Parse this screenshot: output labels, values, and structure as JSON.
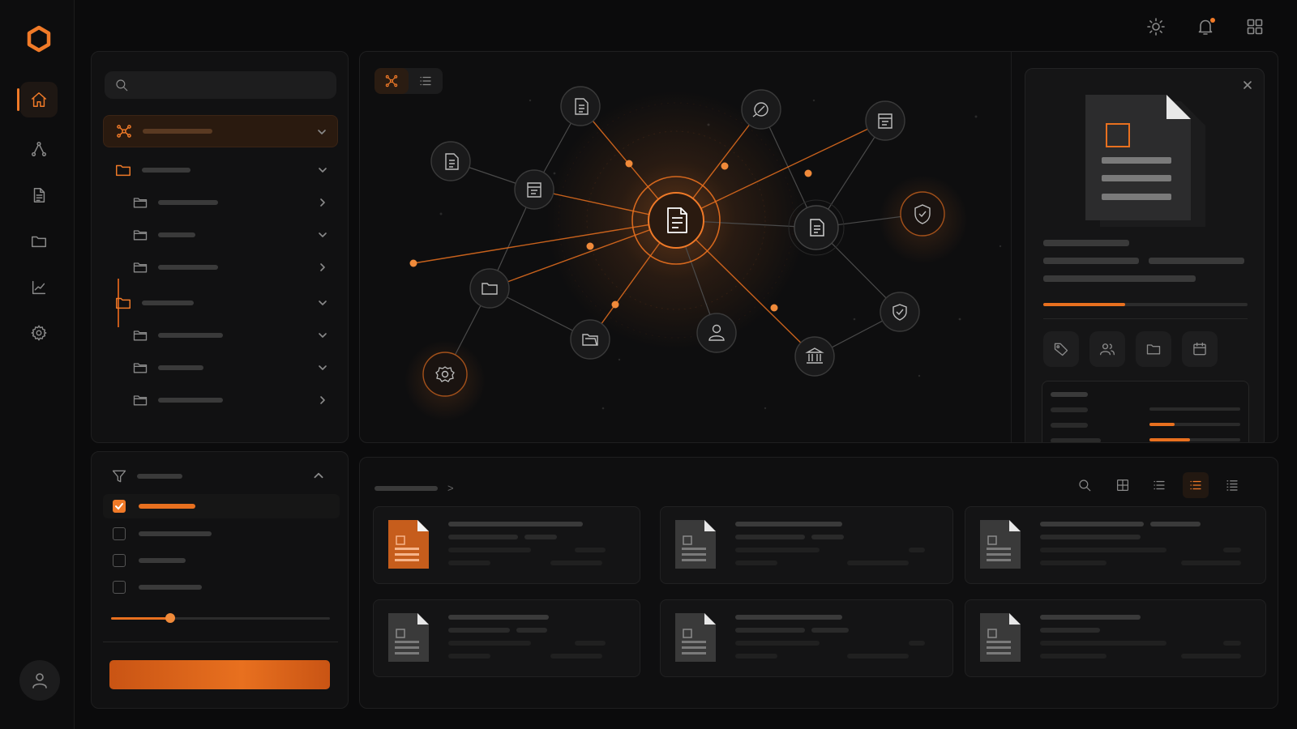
{
  "app": {
    "accent": "#f07a28",
    "background": "#0b0b0c"
  },
  "rail": {
    "logo": "hexagon-logo-icon",
    "items": [
      {
        "icon": "home-icon",
        "active": true
      },
      {
        "icon": "graph-icon",
        "active": false
      },
      {
        "icon": "document-icon",
        "active": false
      },
      {
        "icon": "folder-icon",
        "active": false
      },
      {
        "icon": "analytics-icon",
        "active": false
      },
      {
        "icon": "settings-icon",
        "active": false
      }
    ],
    "avatar": "user-icon"
  },
  "topbar": {
    "icons": [
      "sun-icon",
      "bell-icon",
      "apps-grid-icon"
    ],
    "notification_dot": true
  },
  "tree": {
    "search": {
      "value": "",
      "placeholder": ""
    },
    "rows": [
      {
        "level": 0,
        "icon": "network-icon",
        "expanded": true,
        "active": true
      },
      {
        "level": 0,
        "icon": "folder-icon",
        "expanded": true
      },
      {
        "level": 1,
        "icon": "folder-icon",
        "expanded": false
      },
      {
        "level": 1,
        "icon": "folder-icon",
        "expanded": true
      },
      {
        "level": 1,
        "icon": "folder-icon",
        "expanded": false
      },
      {
        "level": 0,
        "icon": "folder-icon",
        "expanded": true
      },
      {
        "level": 1,
        "icon": "folder-icon",
        "expanded": true
      },
      {
        "level": 1,
        "icon": "folder-icon",
        "expanded": true
      },
      {
        "level": 1,
        "icon": "folder-icon",
        "expanded": false
      }
    ]
  },
  "filter": {
    "icon": "filter-icon",
    "expanded": true,
    "options": [
      {
        "checked": true
      },
      {
        "checked": false
      },
      {
        "checked": false
      },
      {
        "checked": false
      }
    ],
    "slider_fraction": 0.27,
    "apply_button": ""
  },
  "graph": {
    "view_modes": [
      {
        "icon": "graph-view-icon",
        "active": true
      },
      {
        "icon": "list-view-icon",
        "active": false
      }
    ],
    "nodes": [
      {
        "id": "center",
        "icon": "document-icon",
        "highlight": "primary"
      },
      {
        "id": "n1",
        "icon": "document-icon"
      },
      {
        "id": "n2",
        "icon": "document-icon"
      },
      {
        "id": "n3",
        "icon": "link-icon"
      },
      {
        "id": "n4",
        "icon": "spreadsheet-icon"
      },
      {
        "id": "n5",
        "icon": "document-icon"
      },
      {
        "id": "n6",
        "icon": "document-icon"
      },
      {
        "id": "n7",
        "icon": "shield-icon",
        "highlight": "secondary"
      },
      {
        "id": "n8",
        "icon": "folder-icon"
      },
      {
        "id": "n9",
        "icon": "folder-open-icon"
      },
      {
        "id": "n10",
        "icon": "user-icon"
      },
      {
        "id": "n11",
        "icon": "bank-icon"
      },
      {
        "id": "n12",
        "icon": "shield-icon"
      },
      {
        "id": "n13",
        "icon": "settings-icon",
        "highlight": "secondary"
      }
    ]
  },
  "detail": {
    "close_icon": "close-icon",
    "preview_icon": "document-large-icon",
    "progress_fraction": 0.4,
    "actions": [
      "tag-icon",
      "users-icon",
      "folder-icon",
      "calendar-icon"
    ],
    "stats": [
      {
        "fraction": 0
      },
      {
        "fraction": 0.28
      },
      {
        "fraction": 0.45
      }
    ]
  },
  "files": {
    "breadcrumb_separator": ">",
    "toolbar": [
      {
        "icon": "search-icon",
        "active": false
      },
      {
        "icon": "grid-view-icon",
        "active": false
      },
      {
        "icon": "list-view-icon",
        "active": false
      },
      {
        "icon": "detail-list-icon",
        "active": true
      },
      {
        "icon": "compact-list-icon",
        "active": false
      }
    ],
    "cards": [
      {
        "icon": "document-icon",
        "highlight": true
      },
      {
        "icon": "document-icon",
        "highlight": false
      },
      {
        "icon": "document-icon",
        "highlight": false
      },
      {
        "icon": "document-icon",
        "highlight": false
      },
      {
        "icon": "document-icon",
        "highlight": false
      },
      {
        "icon": "document-icon",
        "highlight": false
      }
    ]
  }
}
